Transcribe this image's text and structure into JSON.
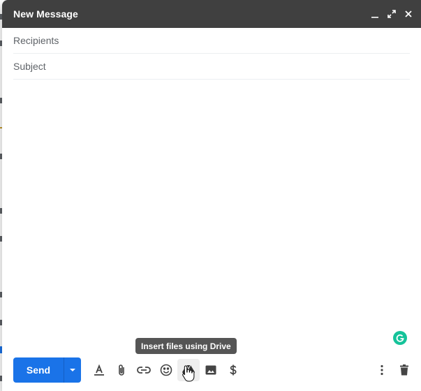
{
  "compose": {
    "title": "New Message",
    "recipients_placeholder": "Recipients",
    "subject_placeholder": "Subject",
    "send_label": "Send",
    "tooltip": "Insert files using Drive"
  },
  "header_buttons": [
    "minimize-icon",
    "fullscreen-icon",
    "close-icon"
  ],
  "toolbar_icons": [
    "formatting-options-icon",
    "attach-files-icon",
    "insert-link-icon",
    "insert-emoji-icon",
    "google-drive-icon",
    "insert-photo-icon",
    "send-money-icon",
    "more-options-icon",
    "discard-draft-icon"
  ],
  "colors": {
    "header_bg": "#404040",
    "send_button": "#1a73e8",
    "grammarly": "#15c39a",
    "tooltip_bg": "#555555"
  }
}
